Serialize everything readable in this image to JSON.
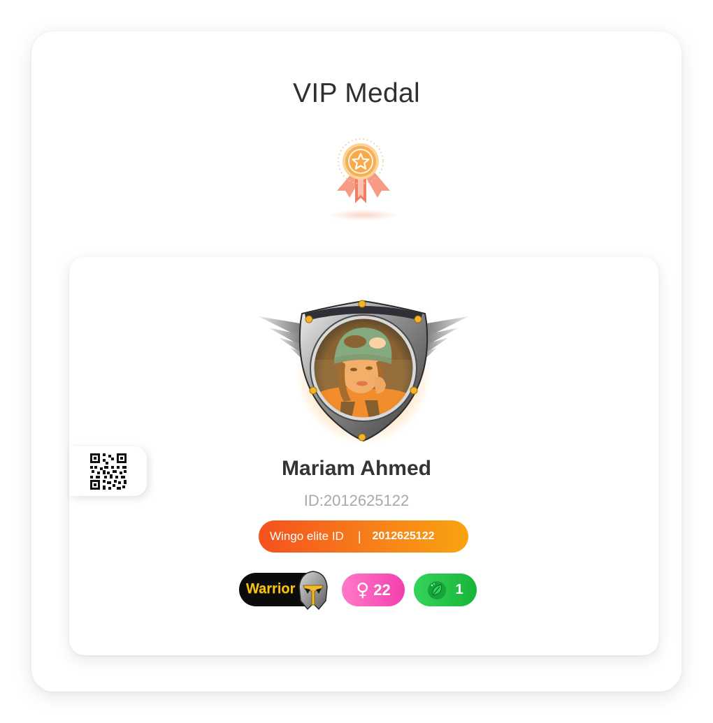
{
  "page": {
    "title": "VIP Medal"
  },
  "medal": {
    "icon": "vip-medal-icon",
    "colors": {
      "ring": "#f9b76b",
      "ribbon": "#f48a6e",
      "star": "#f4a64f"
    }
  },
  "profile": {
    "name": "Mariam Ahmed",
    "id_text": "ID:2012625122",
    "elite_label": "Wingo elite ID",
    "elite_separator": "|",
    "elite_id": "2012625122",
    "qr_icon": "qr-code-icon",
    "frame_icon": "winged-shield-frame"
  },
  "badges": {
    "rank_label": "Warrior",
    "gender_symbol": "♀",
    "age": "22",
    "level": "1"
  },
  "colors": {
    "elite_start": "#f4511e",
    "elite_end": "#f9a30f",
    "gender_pink": "#f43fae",
    "level_green": "#18b53b",
    "warrior_gold": "#f6c21a"
  }
}
